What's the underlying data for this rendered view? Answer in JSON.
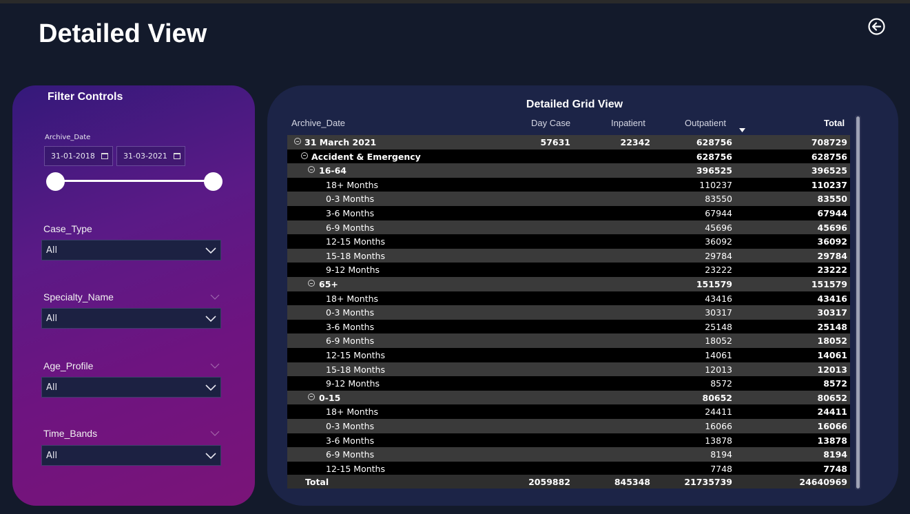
{
  "page_title": "Detailed View",
  "filters": {
    "title": "Filter Controls",
    "archive_date": {
      "label": "Archive_Date",
      "start": "31-01-2018",
      "end": "31-03-2021"
    },
    "case_type": {
      "label": "Case_Type",
      "value": "All"
    },
    "specialty_name": {
      "label": "Specialty_Name",
      "value": "All"
    },
    "age_profile": {
      "label": "Age_Profile",
      "value": "All"
    },
    "time_bands": {
      "label": "Time_Bands",
      "value": "All"
    }
  },
  "grid": {
    "title": "Detailed Grid View",
    "columns": {
      "archive_date": "Archive_Date",
      "day_case": "Day Case",
      "inpatient": "Inpatient",
      "outpatient": "Outpatient",
      "total": "Total"
    },
    "sorted_column": "outpatient",
    "rows": [
      {
        "level": 0,
        "label": "31 March 2021",
        "day_case": "57631",
        "inpatient": "22342",
        "outpatient": "628756",
        "total": "708729",
        "expandable": true
      },
      {
        "level": 1,
        "label": "Accident & Emergency",
        "day_case": "",
        "inpatient": "",
        "outpatient": "628756",
        "total": "628756",
        "expandable": true
      },
      {
        "level": 2,
        "label": "16-64",
        "day_case": "",
        "inpatient": "",
        "outpatient": "396525",
        "total": "396525",
        "expandable": true
      },
      {
        "level": 3,
        "label": "18+ Months",
        "day_case": "",
        "inpatient": "",
        "outpatient": "110237",
        "total": "110237"
      },
      {
        "level": 3,
        "label": "0-3 Months",
        "day_case": "",
        "inpatient": "",
        "outpatient": "83550",
        "total": "83550"
      },
      {
        "level": 3,
        "label": "3-6 Months",
        "day_case": "",
        "inpatient": "",
        "outpatient": "67944",
        "total": "67944"
      },
      {
        "level": 3,
        "label": "6-9 Months",
        "day_case": "",
        "inpatient": "",
        "outpatient": "45696",
        "total": "45696"
      },
      {
        "level": 3,
        "label": "12-15 Months",
        "day_case": "",
        "inpatient": "",
        "outpatient": "36092",
        "total": "36092"
      },
      {
        "level": 3,
        "label": "15-18 Months",
        "day_case": "",
        "inpatient": "",
        "outpatient": "29784",
        "total": "29784"
      },
      {
        "level": 3,
        "label": "9-12 Months",
        "day_case": "",
        "inpatient": "",
        "outpatient": "23222",
        "total": "23222"
      },
      {
        "level": 2,
        "label": "65+",
        "day_case": "",
        "inpatient": "",
        "outpatient": "151579",
        "total": "151579",
        "expandable": true
      },
      {
        "level": 3,
        "label": "18+ Months",
        "day_case": "",
        "inpatient": "",
        "outpatient": "43416",
        "total": "43416"
      },
      {
        "level": 3,
        "label": "0-3 Months",
        "day_case": "",
        "inpatient": "",
        "outpatient": "30317",
        "total": "30317"
      },
      {
        "level": 3,
        "label": "3-6 Months",
        "day_case": "",
        "inpatient": "",
        "outpatient": "25148",
        "total": "25148"
      },
      {
        "level": 3,
        "label": "6-9 Months",
        "day_case": "",
        "inpatient": "",
        "outpatient": "18052",
        "total": "18052"
      },
      {
        "level": 3,
        "label": "12-15 Months",
        "day_case": "",
        "inpatient": "",
        "outpatient": "14061",
        "total": "14061"
      },
      {
        "level": 3,
        "label": "15-18 Months",
        "day_case": "",
        "inpatient": "",
        "outpatient": "12013",
        "total": "12013"
      },
      {
        "level": 3,
        "label": "9-12 Months",
        "day_case": "",
        "inpatient": "",
        "outpatient": "8572",
        "total": "8572"
      },
      {
        "level": 2,
        "label": "0-15",
        "day_case": "",
        "inpatient": "",
        "outpatient": "80652",
        "total": "80652",
        "expandable": true
      },
      {
        "level": 3,
        "label": "18+ Months",
        "day_case": "",
        "inpatient": "",
        "outpatient": "24411",
        "total": "24411"
      },
      {
        "level": 3,
        "label": "0-3 Months",
        "day_case": "",
        "inpatient": "",
        "outpatient": "16066",
        "total": "16066"
      },
      {
        "level": 3,
        "label": "3-6 Months",
        "day_case": "",
        "inpatient": "",
        "outpatient": "13878",
        "total": "13878"
      },
      {
        "level": 3,
        "label": "6-9 Months",
        "day_case": "",
        "inpatient": "",
        "outpatient": "8194",
        "total": "8194"
      },
      {
        "level": 3,
        "label": "12-15 Months",
        "day_case": "",
        "inpatient": "",
        "outpatient": "7748",
        "total": "7748"
      }
    ],
    "totals": {
      "label": "Total",
      "day_case": "2059882",
      "inpatient": "845348",
      "outpatient": "21735739",
      "total": "24640969"
    }
  },
  "colors": {
    "background": "#131a2b",
    "grid_panel": "#1c2447",
    "filter_gradient_start": "#34197a",
    "filter_gradient_end": "#7a1478",
    "row_dark": "#000000",
    "row_light": "#3a3a3a"
  },
  "icons": {
    "back": "back-arrow-circle-icon",
    "calendar": "calendar-icon",
    "dropdown": "chevron-down-icon",
    "expander": "collapse-minus-icon",
    "sort": "sort-descending-icon"
  }
}
